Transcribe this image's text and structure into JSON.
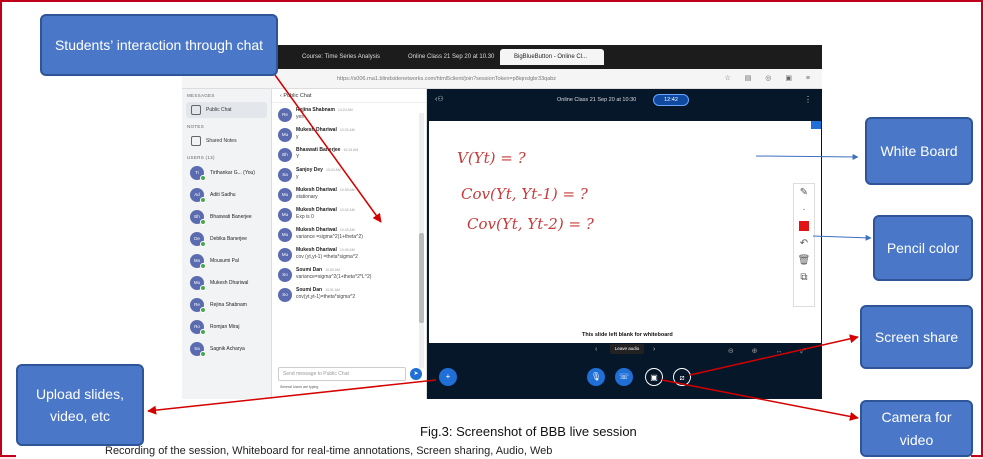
{
  "callouts": {
    "students_chat": "Students’ interaction through chat",
    "white_board": "White Board",
    "pencil_color": "Pencil color",
    "screen_share": "Screen share",
    "upload": "Upload slides, video, etc",
    "camera": "Camera for video"
  },
  "caption": "Fig.3: Screenshot of BBB live session",
  "body_text": "Recording of the session, Whiteboard for real-time annotations, Screen sharing, Audio, Web",
  "browser": {
    "tabs": [
      "Course: Time Series Analysis",
      "Online Class 21 Sep 20 at 10.30",
      "BigBlueButton - Online Cl..."
    ],
    "url": "https://s006.rna1.blindsidenetworks.com/html5client/join?sessionToken=p8iqnslgbr33qabz"
  },
  "left": {
    "messages_hdr": "MESSAGES",
    "public_chat": "Public Chat",
    "notes_hdr": "NOTES",
    "shared_notes": "Shared Notes",
    "users_hdr": "USERS (13)",
    "users": [
      {
        "initials": "Ti",
        "name": "Tirthankar G... (You)"
      },
      {
        "initials": "Ad",
        "name": "Aditi Sadhu"
      },
      {
        "initials": "Bh",
        "name": "Bhaswati Banerjee"
      },
      {
        "initials": "De",
        "name": "Debika Banerjee"
      },
      {
        "initials": "Mo",
        "name": "Mousumi Pal"
      },
      {
        "initials": "Mu",
        "name": "Mukesh Dhariwal"
      },
      {
        "initials": "Re",
        "name": "Rejina Shabnam"
      },
      {
        "initials": "Ro",
        "name": "Romjan Miraj"
      },
      {
        "initials": "Sa",
        "name": "Sagnik Acharya"
      }
    ]
  },
  "chat": {
    "header": "Public Chat",
    "messages": [
      {
        "initials": "Re",
        "name": "Rejina Shabnam",
        "time": "10:24 AM",
        "text": "yes"
      },
      {
        "initials": "Mu",
        "name": "Mukesh Dhariwal",
        "time": "10:24 AM",
        "text": "y"
      },
      {
        "initials": "Bh",
        "name": "Bhaswati Banerjee",
        "time": "10:24 AM",
        "text": "Y"
      },
      {
        "initials": "Sa",
        "name": "Sanjoy Dey",
        "time": "10:24 AM",
        "text": "y"
      },
      {
        "initials": "Mu",
        "name": "Mukesh Dhariwal",
        "time": "10:39 AM",
        "text": "stationary"
      },
      {
        "initials": "Mu",
        "name": "Mukesh Dhariwal",
        "time": "10:42 AM",
        "text": "Exp is 0"
      },
      {
        "initials": "Mu",
        "name": "Mukesh Dhariwal",
        "time": "10:43 AM",
        "text": "variance =sigma^2(1+theta^2)"
      },
      {
        "initials": "Mu",
        "name": "Mukesh Dhariwal",
        "time": "10:49 AM",
        "text": "cov (yt,yt-1) =theta*sigma^2"
      },
      {
        "initials": "So",
        "name": "Soumi Dan",
        "time": "10:50 AM",
        "text": "variance=sigma^2(1+theta^2*L^2)"
      },
      {
        "initials": "So",
        "name": "Soumi Dan",
        "time": "10:51 AM",
        "text": "cov(yt,yt-1)=theta*sigma^2"
      }
    ],
    "input_placeholder": "Send message to Public Chat",
    "typing": "Several Users are typing"
  },
  "main": {
    "session_name": "Online Class 21 Sep 20 at 10:30",
    "timer": "12:42",
    "wb_lines": [
      "V(Yt) = ?",
      "Cov(Yt, Yt-1) = ?",
      "Cov(Yt, Yt-2) = ?"
    ],
    "blank_text": "This slide left blank for whiteboard",
    "leave_audio": "Leave audio",
    "pencil_color": "#e21414"
  }
}
